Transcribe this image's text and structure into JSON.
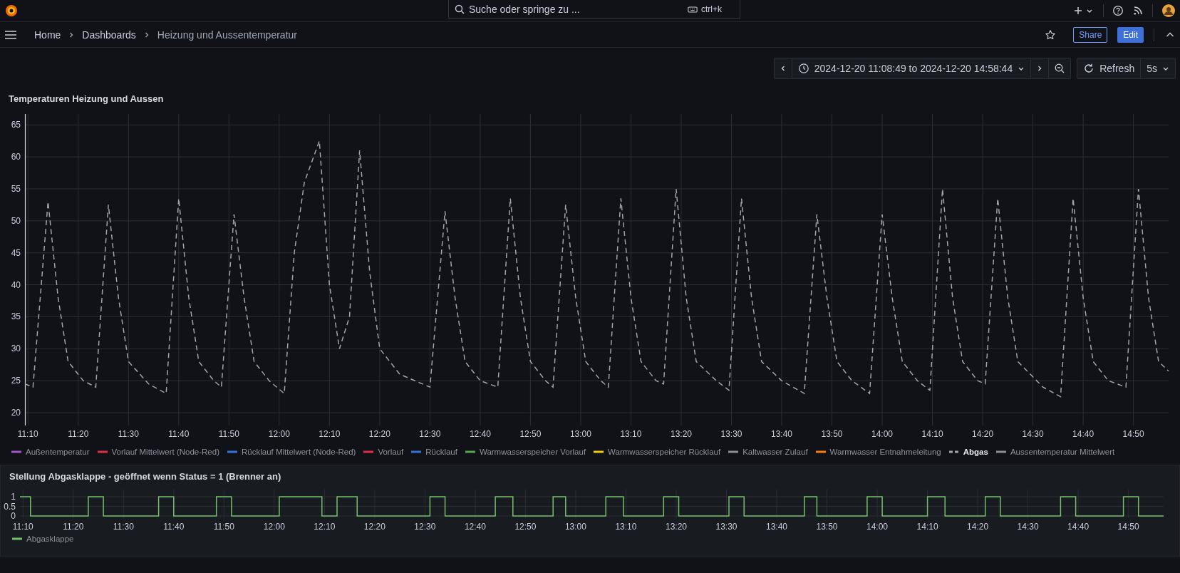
{
  "topbar": {
    "search": {
      "placeholder": "Suche oder springe zu ...",
      "shortcut": "ctrl+k"
    }
  },
  "breadcrumbs": [
    {
      "label": "Home",
      "current": false
    },
    {
      "label": "Dashboards",
      "current": false
    },
    {
      "label": "Heizung und Aussentemperatur",
      "current": true
    }
  ],
  "toolbar": {
    "share": "Share",
    "edit": "Edit"
  },
  "time_picker": {
    "range": "2024-12-20 11:08:49 to 2024-12-20 14:58:44",
    "refresh": "Refresh",
    "interval": "5s"
  },
  "panels": [
    {
      "title": "Temperaturen Heizung und Aussen",
      "chart_data": {
        "type": "line",
        "grid": true,
        "xlim": [
          669.4,
          897
        ],
        "ylim": [
          18,
          66.7
        ],
        "xticks": [
          {
            "value": 670,
            "label": "11:10"
          },
          {
            "value": 680,
            "label": "11:20"
          },
          {
            "value": 690,
            "label": "11:30"
          },
          {
            "value": 700,
            "label": "11:40"
          },
          {
            "value": 710,
            "label": "11:50"
          },
          {
            "value": 720,
            "label": "12:00"
          },
          {
            "value": 730,
            "label": "12:10"
          },
          {
            "value": 740,
            "label": "12:20"
          },
          {
            "value": 750,
            "label": "12:30"
          },
          {
            "value": 760,
            "label": "12:40"
          },
          {
            "value": 770,
            "label": "12:50"
          },
          {
            "value": 780,
            "label": "13:00"
          },
          {
            "value": 790,
            "label": "13:10"
          },
          {
            "value": 800,
            "label": "13:20"
          },
          {
            "value": 810,
            "label": "13:30"
          },
          {
            "value": 820,
            "label": "13:40"
          },
          {
            "value": 830,
            "label": "13:50"
          },
          {
            "value": 840,
            "label": "14:00"
          },
          {
            "value": 850,
            "label": "14:10"
          },
          {
            "value": 860,
            "label": "14:20"
          },
          {
            "value": 870,
            "label": "14:30"
          },
          {
            "value": 880,
            "label": "14:40"
          },
          {
            "value": 890,
            "label": "14:50"
          }
        ],
        "yticks": [
          20,
          25,
          30,
          35,
          40,
          45,
          50,
          55,
          60,
          65
        ],
        "x": [
          669.4,
          671,
          674,
          676,
          678,
          681,
          683.5,
          686,
          688,
          690,
          694,
          697.5,
          700,
          702,
          704,
          707,
          708.5,
          711,
          713,
          715,
          718,
          721,
          723,
          725,
          728,
          730,
          732,
          734,
          736,
          738,
          740,
          744,
          750,
          753,
          755,
          757,
          760,
          763.5,
          766,
          768,
          770,
          773,
          774.5,
          777,
          779,
          781,
          784,
          785.5,
          788,
          790,
          792,
          795,
          796.5,
          799,
          801,
          803,
          807,
          809.5,
          812,
          814,
          816,
          820,
          824.5,
          827,
          829,
          831,
          834,
          837.5,
          840,
          842,
          844,
          847,
          849.5,
          852,
          854,
          856,
          859,
          860.5,
          863,
          865,
          867,
          872,
          875.5,
          878,
          880,
          882,
          885,
          888.5,
          891,
          893,
          895,
          897
        ],
        "series": [
          {
            "color": "#a3a3a8",
            "line_style": "dashed",
            "values": [
              24.5,
              24,
              53,
              38,
              28,
              25,
              24,
              52.5,
              38,
              28,
              24.5,
              23,
              53.5,
              38,
              28,
              25,
              24,
              51,
              38,
              28,
              25,
              23,
              45,
              56,
              62.5,
              40,
              30,
              35,
              61,
              42,
              30,
              26,
              24,
              51.5,
              38,
              28,
              25,
              24,
              53.5,
              38,
              28,
              25,
              24,
              52.5,
              38,
              28,
              25,
              24,
              53.5,
              38,
              28,
              25,
              24.5,
              55,
              38,
              28,
              25,
              23.5,
              53.5,
              38,
              28,
              25,
              23,
              51,
              38,
              28,
              25,
              23,
              51,
              38,
              28,
              25,
              23.5,
              55,
              38,
              28,
              25,
              24.5,
              53.5,
              38,
              28,
              24,
              22.5,
              53.5,
              38,
              28,
              25,
              24,
              55,
              38,
              28,
              26.5
            ]
          }
        ]
      },
      "legend": [
        {
          "name": "Außentemperatur",
          "color": "#a352cc",
          "kind": "solid",
          "selected": false
        },
        {
          "name": "Vorlauf Mittelwert (Node-Red)",
          "color": "#e02f44",
          "kind": "solid",
          "selected": false
        },
        {
          "name": "Rücklauf Mittelwert (Node-Red)",
          "color": "#3274d9",
          "kind": "solid",
          "selected": false
        },
        {
          "name": "Vorlauf",
          "color": "#e02f44",
          "kind": "solid",
          "selected": false
        },
        {
          "name": "Rücklauf",
          "color": "#3274d9",
          "kind": "solid",
          "selected": false
        },
        {
          "name": "Warmwasserspeicher Vorlauf",
          "color": "#56a64b",
          "kind": "solid",
          "selected": false
        },
        {
          "name": "Warmwasserspeicher Rücklauf",
          "color": "#f2cc0c",
          "kind": "solid",
          "selected": false
        },
        {
          "name": "Kaltwasser Zulauf",
          "color": "#8e8e8e",
          "kind": "solid",
          "selected": false
        },
        {
          "name": "Warmwasser Entnahmeleitung",
          "color": "#ff780a",
          "kind": "solid",
          "selected": false
        },
        {
          "name": "Abgas",
          "color": "#a3a3a8",
          "kind": "dashed",
          "selected": true
        },
        {
          "name": "Aussentemperatur Mittelwert",
          "color": "#8e8e8e",
          "kind": "solid",
          "selected": false
        }
      ]
    },
    {
      "title": "Stellung Abgasklappe - geöffnet wenn Status = 1 (Brenner an)",
      "chart_data": {
        "type": "line",
        "grid": true,
        "xlim": [
          669.4,
          897
        ],
        "ylim": [
          -0.11,
          1.37
        ],
        "xticks": [
          {
            "value": 670,
            "label": "11:10"
          },
          {
            "value": 680,
            "label": "11:20"
          },
          {
            "value": 690,
            "label": "11:30"
          },
          {
            "value": 700,
            "label": "11:40"
          },
          {
            "value": 710,
            "label": "11:50"
          },
          {
            "value": 720,
            "label": "12:00"
          },
          {
            "value": 730,
            "label": "12:10"
          },
          {
            "value": 740,
            "label": "12:20"
          },
          {
            "value": 750,
            "label": "12:30"
          },
          {
            "value": 760,
            "label": "12:40"
          },
          {
            "value": 770,
            "label": "12:50"
          },
          {
            "value": 780,
            "label": "13:00"
          },
          {
            "value": 790,
            "label": "13:10"
          },
          {
            "value": 800,
            "label": "13:20"
          },
          {
            "value": 810,
            "label": "13:30"
          },
          {
            "value": 820,
            "label": "13:40"
          },
          {
            "value": 830,
            "label": "13:50"
          },
          {
            "value": 840,
            "label": "14:00"
          },
          {
            "value": 850,
            "label": "14:10"
          },
          {
            "value": 860,
            "label": "14:20"
          },
          {
            "value": 870,
            "label": "14:30"
          },
          {
            "value": 880,
            "label": "14:40"
          },
          {
            "value": 890,
            "label": "14:50"
          }
        ],
        "yticks": [
          0,
          0.5,
          1
        ],
        "x": [
          669.4,
          671.5,
          671.5,
          683,
          683,
          686,
          686,
          697,
          697,
          700,
          700,
          708.5,
          708.5,
          711.5,
          711.5,
          721,
          721,
          729.5,
          729.5,
          732.5,
          732.5,
          736.5,
          736.5,
          751,
          751,
          754,
          754,
          764,
          764,
          767.5,
          767.5,
          775.5,
          775.5,
          778,
          778,
          786,
          786,
          789.5,
          789.5,
          797.5,
          797.5,
          800.5,
          800.5,
          810.5,
          810.5,
          813.5,
          813.5,
          825.5,
          825.5,
          828,
          828,
          838,
          838,
          841,
          841,
          850,
          850,
          853.5,
          853.5,
          861.5,
          861.5,
          864.5,
          864.5,
          876.5,
          876.5,
          879.5,
          879.5,
          889,
          889,
          892,
          892,
          897
        ],
        "series": [
          {
            "color": "#73bf69",
            "line_style": "solid",
            "values": [
              1,
              1,
              0,
              0,
              1,
              1,
              0,
              0,
              1,
              1,
              0,
              0,
              1,
              1,
              0,
              0,
              1,
              1,
              0,
              0,
              1,
              1,
              0,
              0,
              1,
              1,
              0,
              0,
              1,
              1,
              0,
              0,
              1,
              1,
              0,
              0,
              1,
              1,
              0,
              0,
              1,
              1,
              0,
              0,
              1,
              1,
              0,
              0,
              1,
              1,
              0,
              0,
              1,
              1,
              0,
              0,
              1,
              1,
              0,
              0,
              1,
              1,
              0,
              0,
              1,
              1,
              0,
              0,
              1,
              1,
              0,
              0
            ]
          }
        ]
      },
      "legend": [
        {
          "name": "Abgasklappe",
          "color": "#73bf69",
          "kind": "solid",
          "selected": false
        }
      ]
    }
  ]
}
